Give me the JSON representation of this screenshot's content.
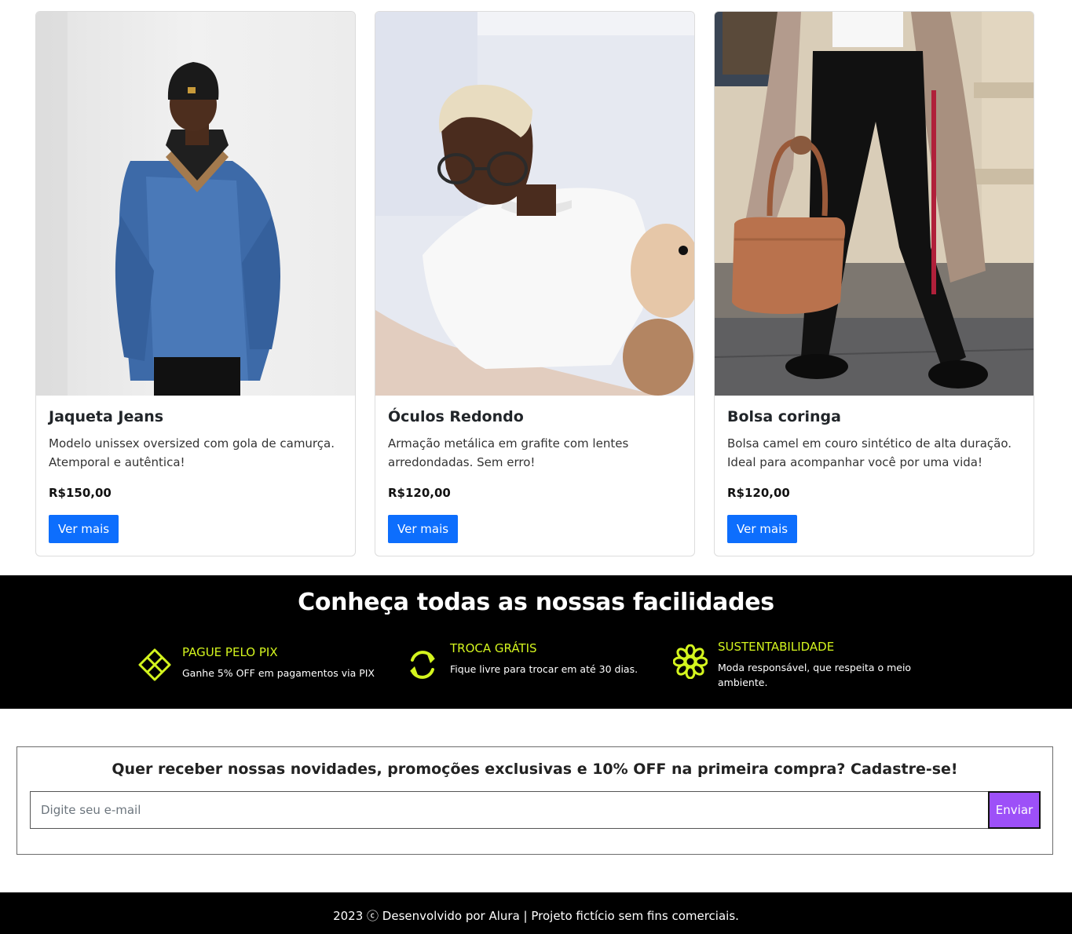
{
  "products": [
    {
      "title": "Jaqueta Jeans",
      "description": "Modelo unissex oversized com gola de camurça. Atemporal e autêntica!",
      "price": "R$150,00",
      "button_label": "Ver mais"
    },
    {
      "title": "Óculos Redondo",
      "description": "Armação metálica em grafite com lentes arredondadas. Sem erro!",
      "price": "R$120,00",
      "button_label": "Ver mais"
    },
    {
      "title": "Bolsa coringa",
      "description": "Bolsa camel em couro sintético de alta duração. Ideal para acompanhar você por uma vida!",
      "price": "R$120,00",
      "button_label": "Ver mais"
    }
  ],
  "features": {
    "title": "Conheça todas as nossas facilidades",
    "items": [
      {
        "icon": "diamond-grid-icon",
        "title": "PAGUE PELO PIX",
        "description": "Ganhe 5% OFF em pagamentos via PIX"
      },
      {
        "icon": "exchange-arrows-icon",
        "title": "TROCA GRÁTIS",
        "description": "Fique livre para trocar em até 30 dias."
      },
      {
        "icon": "flower-icon",
        "title": "SUSTENTABILIDADE",
        "description": "Moda responsável, que respeita o meio ambiente."
      }
    ]
  },
  "newsletter": {
    "text": "Quer receber nossas novidades, promoções exclusivas e 10% OFF na primeira compra? Cadastre-se!",
    "placeholder": "Digite seu e-mail",
    "button_label": "Enviar"
  },
  "footer": {
    "text": "2023 ⓒ Desenvolvido por Alura | Projeto fictício sem fins comerciais."
  },
  "colors": {
    "primary_button": "#0d6efd",
    "accent": "#d4f51e",
    "send_button": "#9d50f8",
    "band_background": "#000000"
  }
}
